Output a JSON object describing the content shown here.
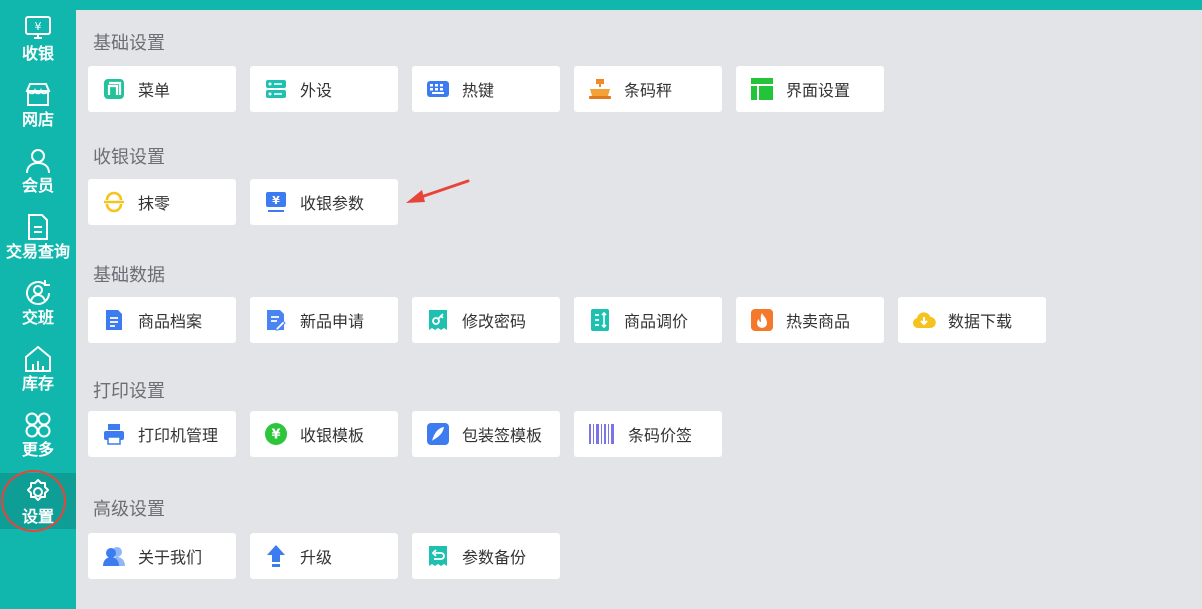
{
  "sidebar": {
    "items": [
      {
        "label": "收银",
        "icon": "cashier-monitor-icon"
      },
      {
        "label": "网店",
        "icon": "store-icon"
      },
      {
        "label": "会员",
        "icon": "member-icon"
      },
      {
        "label": "交易查询",
        "icon": "document-icon"
      },
      {
        "label": "交班",
        "icon": "handover-icon"
      },
      {
        "label": "库存",
        "icon": "warehouse-icon"
      },
      {
        "label": "更多",
        "icon": "grid-more-icon"
      },
      {
        "label": "设置",
        "icon": "gear-icon"
      }
    ],
    "active": "设置",
    "colors": {
      "bg": "#11b7ac",
      "active_bg": "#0e9e95",
      "highlight_ring": "#e8453a"
    }
  },
  "sections": [
    {
      "title": "基础设置",
      "items": [
        {
          "label": "菜单",
          "icon": "menu-icon"
        },
        {
          "label": "外设",
          "icon": "peripheral-icon"
        },
        {
          "label": "热键",
          "icon": "keyboard-icon"
        },
        {
          "label": "条码秤",
          "icon": "barcode-scale-icon"
        },
        {
          "label": "界面设置",
          "icon": "layout-icon"
        }
      ]
    },
    {
      "title": "收银设置",
      "items": [
        {
          "label": "抹零",
          "icon": "round-off-icon"
        },
        {
          "label": "收银参数",
          "icon": "cashier-params-icon"
        }
      ]
    },
    {
      "title": "基础数据",
      "items": [
        {
          "label": "商品档案",
          "icon": "product-file-icon"
        },
        {
          "label": "新品申请",
          "icon": "new-product-icon"
        },
        {
          "label": "修改密码",
          "icon": "key-icon"
        },
        {
          "label": "商品调价",
          "icon": "price-adjust-icon"
        },
        {
          "label": "热卖商品",
          "icon": "fire-icon"
        },
        {
          "label": "数据下载",
          "icon": "cloud-download-icon"
        }
      ]
    },
    {
      "title": "打印设置",
      "items": [
        {
          "label": "打印机管理",
          "icon": "printer-icon"
        },
        {
          "label": "收银模板",
          "icon": "yen-template-icon"
        },
        {
          "label": "包装签模板",
          "icon": "feather-icon"
        },
        {
          "label": "条码价签",
          "icon": "barcode-icon"
        }
      ]
    },
    {
      "title": "高级设置",
      "items": [
        {
          "label": "关于我们",
          "icon": "about-icon"
        },
        {
          "label": "升级",
          "icon": "upgrade-arrow-icon"
        },
        {
          "label": "参数备份",
          "icon": "backup-icon"
        }
      ]
    }
  ],
  "annotation": {
    "points_to": "收银参数",
    "color": "#e8453a"
  }
}
